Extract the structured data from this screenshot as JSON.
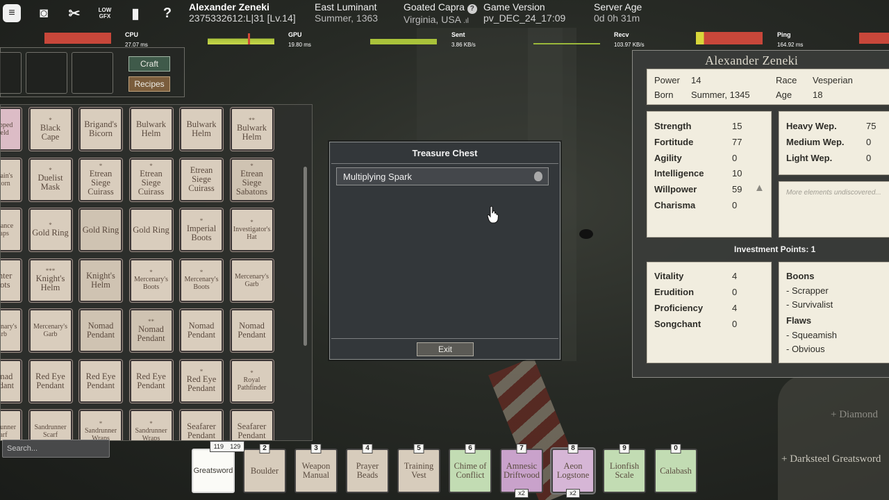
{
  "topbar": {
    "icons": [
      {
        "name": "chat-icon",
        "glyph": "≡"
      },
      {
        "name": "screenshot-icon",
        "glyph": "◙"
      },
      {
        "name": "scissors-icon",
        "glyph": "✂"
      },
      {
        "name": "low-gfx-icon",
        "text": "LOW GFX"
      },
      {
        "name": "journal-icon",
        "glyph": "▮"
      },
      {
        "name": "help-icon",
        "glyph": "?"
      }
    ],
    "player": {
      "name": "Alexander Zeneki",
      "id": "2375332612:L|31 [Lv.14]"
    },
    "region": {
      "name": "East Luminant",
      "season": "Summer, 1363"
    },
    "server": {
      "name": "Goated Capra",
      "location": "Virginia, USA"
    },
    "version": {
      "label": "Game Version",
      "value": "pv_DEC_24_17:09"
    },
    "age": {
      "label": "Server Age",
      "value": "0d 0h 31m"
    }
  },
  "perf": {
    "cpu": {
      "label": "CPU",
      "value": "27.07 ms"
    },
    "gpu": {
      "label": "GPU",
      "value": "19.80 ms"
    },
    "sent": {
      "label": "Sent",
      "value": "3.86 KB/s"
    },
    "recv": {
      "label": "Recv",
      "value": "103.97 KB/s"
    },
    "ping": {
      "label": "Ping",
      "value": "164.92 ms"
    }
  },
  "inventory": {
    "craft_label": "Craft",
    "recipes_label": "Recipes",
    "search_placeholder": "Search...",
    "items": [
      {
        "stars": "",
        "name": "Whipped Shield",
        "style": "pink small"
      },
      {
        "stars": "*",
        "name": "Black Cape",
        "style": ""
      },
      {
        "stars": "",
        "name": "Brigand's Bicorn",
        "style": ""
      },
      {
        "stars": "",
        "name": "Bulwark Helm",
        "style": ""
      },
      {
        "stars": "",
        "name": "Bulwark Helm",
        "style": ""
      },
      {
        "stars": "**",
        "name": "Bulwark Helm",
        "style": ""
      },
      {
        "stars": "",
        "name": "Captain's Tricorn",
        "style": "small"
      },
      {
        "stars": "*",
        "name": "Duelist Mask",
        "style": ""
      },
      {
        "stars": "*",
        "name": "Etrean Siege Cuirass",
        "style": ""
      },
      {
        "stars": "*",
        "name": "Etrean Siege Cuirass",
        "style": ""
      },
      {
        "stars": "",
        "name": "Etrean Siege Cuirass",
        "style": ""
      },
      {
        "stars": "*",
        "name": "Etrean Siege Sabatons",
        "style": "dim"
      },
      {
        "stars": "",
        "name": "Guidance Wraps",
        "style": "small"
      },
      {
        "stars": "*",
        "name": "Gold Ring",
        "style": ""
      },
      {
        "stars": "",
        "name": "Gold Ring",
        "style": "dim"
      },
      {
        "stars": "",
        "name": "Gold Ring",
        "style": ""
      },
      {
        "stars": "*",
        "name": "Imperial Boots",
        "style": ""
      },
      {
        "stars": "*",
        "name": "Investigator's Hat",
        "style": "small"
      },
      {
        "stars": "",
        "name": "Hunter Boots",
        "style": ""
      },
      {
        "stars": "***",
        "name": "Knight's Helm",
        "style": ""
      },
      {
        "stars": "",
        "name": "Knight's Helm",
        "style": "dim"
      },
      {
        "stars": "*",
        "name": "Mercenary's Boots",
        "style": "small"
      },
      {
        "stars": "*",
        "name": "Mercenary's Boots",
        "style": "small"
      },
      {
        "stars": "",
        "name": "Mercenary's Garb",
        "style": "small"
      },
      {
        "stars": "",
        "name": "Mercenary's Garb",
        "style": "small"
      },
      {
        "stars": "",
        "name": "Mercenary's Garb",
        "style": "small"
      },
      {
        "stars": "",
        "name": "Nomad Pendant",
        "style": "dim"
      },
      {
        "stars": "**",
        "name": "Nomad Pendant",
        "style": "dim"
      },
      {
        "stars": "",
        "name": "Nomad Pendant",
        "style": ""
      },
      {
        "stars": "",
        "name": "Nomad Pendant",
        "style": ""
      },
      {
        "stars": "",
        "name": "Nomad Pendant",
        "style": ""
      },
      {
        "stars": "",
        "name": "Red Eye Pendant",
        "style": ""
      },
      {
        "stars": "",
        "name": "Red Eye Pendant",
        "style": ""
      },
      {
        "stars": "",
        "name": "Red Eye Pendant",
        "style": ""
      },
      {
        "stars": "*",
        "name": "Red Eye Pendant",
        "style": ""
      },
      {
        "stars": "*",
        "name": "Royal Pathfinder",
        "style": "small"
      },
      {
        "stars": "",
        "name": "Sandrunner Scarf",
        "style": "small"
      },
      {
        "stars": "",
        "name": "Sandrunner Scarf",
        "style": "small"
      },
      {
        "stars": "*",
        "name": "Sandrunner Wraps",
        "style": "small"
      },
      {
        "stars": "*",
        "name": "Sandrunner Wraps",
        "style": "small"
      },
      {
        "stars": "",
        "name": "Seafarer Pendant",
        "style": ""
      },
      {
        "stars": "",
        "name": "Seafarer Pendant",
        "style": ""
      }
    ]
  },
  "chest": {
    "title": "Treasure Chest",
    "item": "Multiplying Spark",
    "exit_label": "Exit"
  },
  "character": {
    "name": "Alexander Zeneki",
    "bio": {
      "power_label": "Power",
      "power": "14",
      "race_label": "Race",
      "race": "Vesperian",
      "born_label": "Born",
      "born": "Summer, 1345",
      "age_label": "Age",
      "age": "18"
    },
    "attributes": [
      {
        "label": "Strength",
        "value": "15"
      },
      {
        "label": "Fortitude",
        "value": "77"
      },
      {
        "label": "Agility",
        "value": "0"
      },
      {
        "label": "Intelligence",
        "value": "10"
      },
      {
        "label": "Willpower",
        "value": "59"
      },
      {
        "label": "Charisma",
        "value": "0"
      }
    ],
    "weapons": [
      {
        "label": "Heavy Wep.",
        "value": "75"
      },
      {
        "label": "Medium Wep.",
        "value": "0"
      },
      {
        "label": "Light Wep.",
        "value": "0"
      }
    ],
    "elements_note": "More elements undiscovered...",
    "investment": "Investment Points: 1",
    "secondary": [
      {
        "label": "Vitality",
        "value": "4"
      },
      {
        "label": "Erudition",
        "value": "0"
      },
      {
        "label": "Proficiency",
        "value": "4"
      },
      {
        "label": "Songchant",
        "value": "0"
      }
    ],
    "boons_label": "Boons",
    "boons": [
      "- Scrapper",
      "- Survivalist"
    ],
    "flaws_label": "Flaws",
    "flaws": [
      "- Squeamish",
      "- Obvious"
    ]
  },
  "hotbar": {
    "health": [
      "119",
      "129"
    ],
    "slots": [
      {
        "key": "",
        "name": "Greatsword",
        "style": "sel",
        "count": ""
      },
      {
        "key": "2",
        "name": "Boulder",
        "style": "",
        "count": ""
      },
      {
        "key": "3",
        "name": "Weapon Manual",
        "style": "",
        "count": ""
      },
      {
        "key": "4",
        "name": "Prayer Beads",
        "style": "",
        "count": ""
      },
      {
        "key": "5",
        "name": "Training Vest",
        "style": "",
        "count": ""
      },
      {
        "key": "6",
        "name": "Chime of Conflict",
        "style": "green",
        "count": ""
      },
      {
        "key": "7",
        "name": "Amnesic Driftwood",
        "style": "purple",
        "count": "x2"
      },
      {
        "key": "8",
        "name": "Aeon Logstone",
        "style": "purple2",
        "count": "x2"
      },
      {
        "key": "9",
        "name": "Lionfish Scale",
        "style": "green",
        "count": ""
      },
      {
        "key": "0",
        "name": "Calabash",
        "style": "green",
        "count": ""
      }
    ]
  },
  "notifications": [
    "+ Diamond",
    "+ Darksteel Greatsword"
  ]
}
